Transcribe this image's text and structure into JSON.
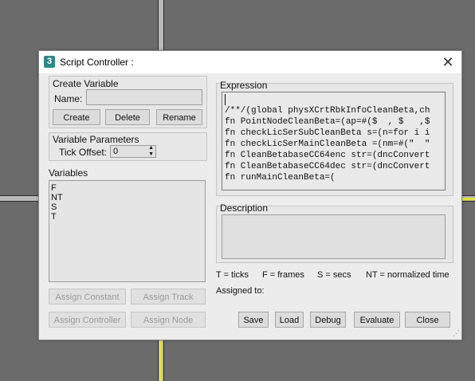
{
  "window": {
    "icon_glyph": "3",
    "title": "Script Controller :",
    "close_glyph": "✕"
  },
  "create_variable": {
    "group_label": "Create Variable",
    "name_label": "Name:",
    "name_value": "",
    "create_label": "Create",
    "delete_label": "Delete",
    "rename_label": "Rename"
  },
  "variable_parameters": {
    "group_label": "Variable Parameters",
    "tick_offset_label": "Tick Offset:",
    "tick_offset_value": "0"
  },
  "variables": {
    "label": "Variables",
    "items": [
      "F",
      "NT",
      "S",
      "T"
    ]
  },
  "assign_buttons": {
    "constant": "Assign Constant",
    "track": "Assign Track",
    "controller": "Assign Controller",
    "node": "Assign Node"
  },
  "expression": {
    "label": "Expression",
    "lines": [
      "",
      "/**/(global physXCrtRbkInfoCleanBeta,ch",
      "fn PointNodeCleanBeta=(ap=#($  , $   ,$",
      "fn checkLicSerSubCleanBeta s=(n=for i i",
      "fn checkLicSerMainCleanBeta =(nm=#(\"  \"",
      "fn CleanBetabaseCC64enc str=(dncConvert",
      "fn CleanBetabaseCC64dec str=(dncConvert",
      "fn runMainCleanBeta=("
    ]
  },
  "description": {
    "label": "Description",
    "value": ""
  },
  "legend": {
    "ticks": "T = ticks",
    "frames": "F = frames",
    "secs": "S = secs",
    "normalized": "NT = normalized time"
  },
  "assigned_to": {
    "label": "Assigned to:"
  },
  "footer_buttons": {
    "save": "Save",
    "load": "Load",
    "debug": "Debug",
    "evaluate": "Evaluate",
    "close": "Close"
  },
  "colors": {
    "viewport": "#6b6b6b",
    "dialog_bg": "#ececec",
    "selection_outline": "#e8e800"
  }
}
